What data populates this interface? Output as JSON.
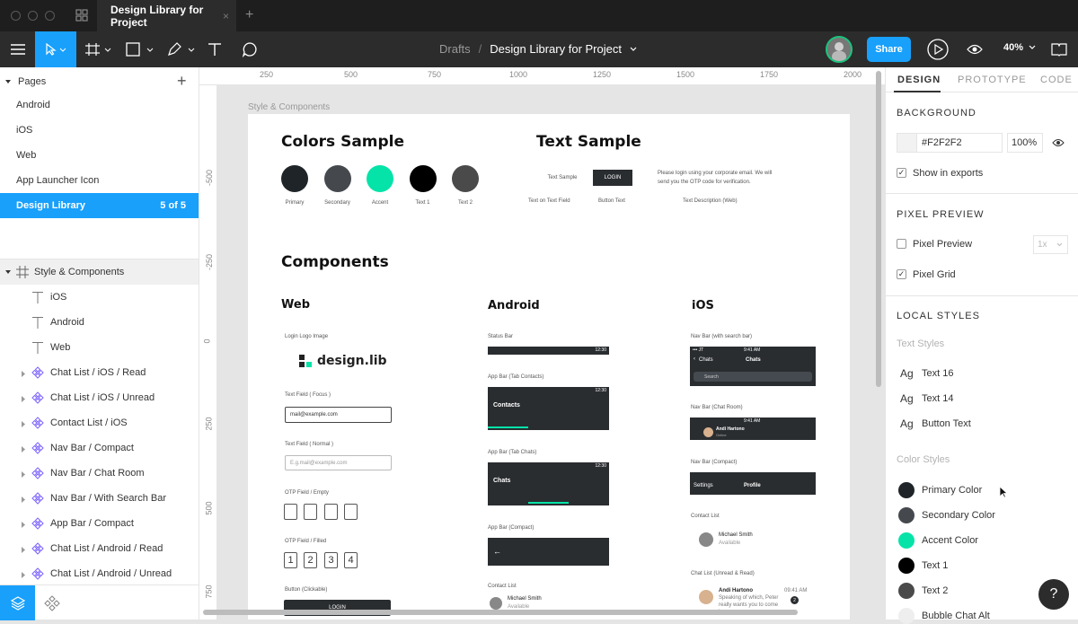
{
  "window": {
    "tab_title": "Design Library for Project",
    "new_tab": "+"
  },
  "toolbar": {
    "breadcrumb_root": "Drafts",
    "breadcrumb_sep": "/",
    "file_title": "Design Library for Project",
    "share": "Share",
    "zoom": "40%"
  },
  "pages": {
    "header": "Pages",
    "items": [
      {
        "label": "Android"
      },
      {
        "label": "iOS"
      },
      {
        "label": "Web"
      },
      {
        "label": "App Launcher Icon"
      },
      {
        "label": "Design Library",
        "count": "5 of 5"
      }
    ]
  },
  "layers": {
    "frame": "Style & Components",
    "items": [
      {
        "label": "iOS",
        "type": "text"
      },
      {
        "label": "Android",
        "type": "text"
      },
      {
        "label": "Web",
        "type": "text"
      },
      {
        "label": "Chat List / iOS / Read",
        "type": "component"
      },
      {
        "label": "Chat List / iOS / Unread",
        "type": "component"
      },
      {
        "label": "Contact List / iOS",
        "type": "component"
      },
      {
        "label": "Nav Bar / Compact",
        "type": "component"
      },
      {
        "label": "Nav Bar / Chat Room",
        "type": "component"
      },
      {
        "label": "Nav Bar / With Search Bar",
        "type": "component"
      },
      {
        "label": "App Bar / Compact",
        "type": "component"
      },
      {
        "label": "Chat List / Android / Read",
        "type": "component"
      },
      {
        "label": "Chat List / Android / Unread",
        "type": "component"
      }
    ]
  },
  "ruler": {
    "x": [
      "250",
      "500",
      "750",
      "1000",
      "1250",
      "1500",
      "1750",
      "2000"
    ],
    "y": [
      "-500",
      "-250",
      "0",
      "250",
      "500",
      "750"
    ]
  },
  "canvas": {
    "frame_label": "Style & Components",
    "colors_title": "Colors Sample",
    "text_title": "Text Sample",
    "colors": [
      {
        "name": "Primary",
        "hex": "#1f2428"
      },
      {
        "name": "Secondary",
        "hex": "#45494e"
      },
      {
        "name": "Accent",
        "hex": "#06e3a9"
      },
      {
        "name": "Text 1",
        "hex": "#000000"
      },
      {
        "name": "Text 2",
        "hex": "#4a4a4a"
      }
    ],
    "text_sample": "Text Sample",
    "login": "LOGIN",
    "text_desc": "Please login using your corporate email. We will send you the OTP code for verification.",
    "text_on_field": "Text on Text Field",
    "button_text": "Button Text",
    "text_desc_web": "Text Description (Web)",
    "components_title": "Components",
    "web": {
      "title": "Web",
      "login_logo_label": "Login Logo Image",
      "logo_text": "design.lib",
      "tf_focus_label": "Text Field ( Focus )",
      "tf_focus_value": "mail@example.com",
      "tf_normal_label": "Text Field ( Normal )",
      "tf_normal_placeholder": "E.g.mail@example.com",
      "otp_empty_label": "OTP Field / Empty",
      "otp_filled_label": "OTP Field / Filled",
      "otp_digits": [
        "1",
        "2",
        "3",
        "4"
      ],
      "button_label": "Button (Clickable)",
      "button_text": "LOGIN"
    },
    "android": {
      "title": "Android",
      "status_label": "Status Bar",
      "time": "12:30",
      "appbar_contacts_label": "App Bar (Tab Contacts)",
      "contacts": "Contacts",
      "appbar_chats_label": "App Bar (Tab Chats)",
      "chats": "Chats",
      "appbar_compact_label": "App Bar (Compact)",
      "contact_list_label": "Contact List",
      "contact_name": "Michael Smith",
      "contact_status": "Available"
    },
    "ios": {
      "title": "iOS",
      "nav_search_label": "Nav Bar (with search bar)",
      "time": "9:41 AM",
      "carrier": "••• JT",
      "chats": "Chats",
      "search": "Search",
      "nav_chat_label": "Nav Bar (Chat Room)",
      "chat_person": "Andi Hartono",
      "chat_status": "Online",
      "nav_compact_label": "Nav Bar (Compact)",
      "settings": "Settings",
      "profile": "Profile",
      "contact_list_label": "Contact List",
      "contact_name": "Michael Smith",
      "contact_status": "Available",
      "chat_list_label": "Chat List (Unread & Read)",
      "chat_name": "Andi Hartono",
      "chat_time": "09:41 AM",
      "chat_preview": "Speaking of which, Peter really wants you to come in...",
      "chat_badge": "2"
    }
  },
  "design_panel": {
    "tabs": [
      "DESIGN",
      "PROTOTYPE",
      "CODE"
    ],
    "background": {
      "title": "BACKGROUND",
      "hex": "#F2F2F2",
      "color": "#f2f2f2",
      "opacity": "100%",
      "show_exports": "Show in exports"
    },
    "pixel_preview": {
      "title": "PIXEL PREVIEW",
      "preview": "Pixel Preview",
      "scale": "1x",
      "grid": "Pixel Grid"
    },
    "local_styles": {
      "title": "LOCAL STYLES",
      "text_styles_label": "Text Styles",
      "text_styles": [
        {
          "ag": "Ag",
          "name": "Text 16"
        },
        {
          "ag": "Ag",
          "name": "Text 14"
        },
        {
          "ag": "Ag",
          "name": "Button Text"
        }
      ],
      "color_styles_label": "Color Styles",
      "color_styles": [
        {
          "name": "Primary Color",
          "color": "#1f2428"
        },
        {
          "name": "Secondary Color",
          "color": "#45494e"
        },
        {
          "name": "Accent Color",
          "color": "#06e3a9"
        },
        {
          "name": "Text 1",
          "color": "#000000"
        },
        {
          "name": "Text 2",
          "color": "#4a4a4a"
        },
        {
          "name": "Bubble Chat Alt",
          "color": "#eeeeee"
        }
      ]
    }
  },
  "help": "?"
}
